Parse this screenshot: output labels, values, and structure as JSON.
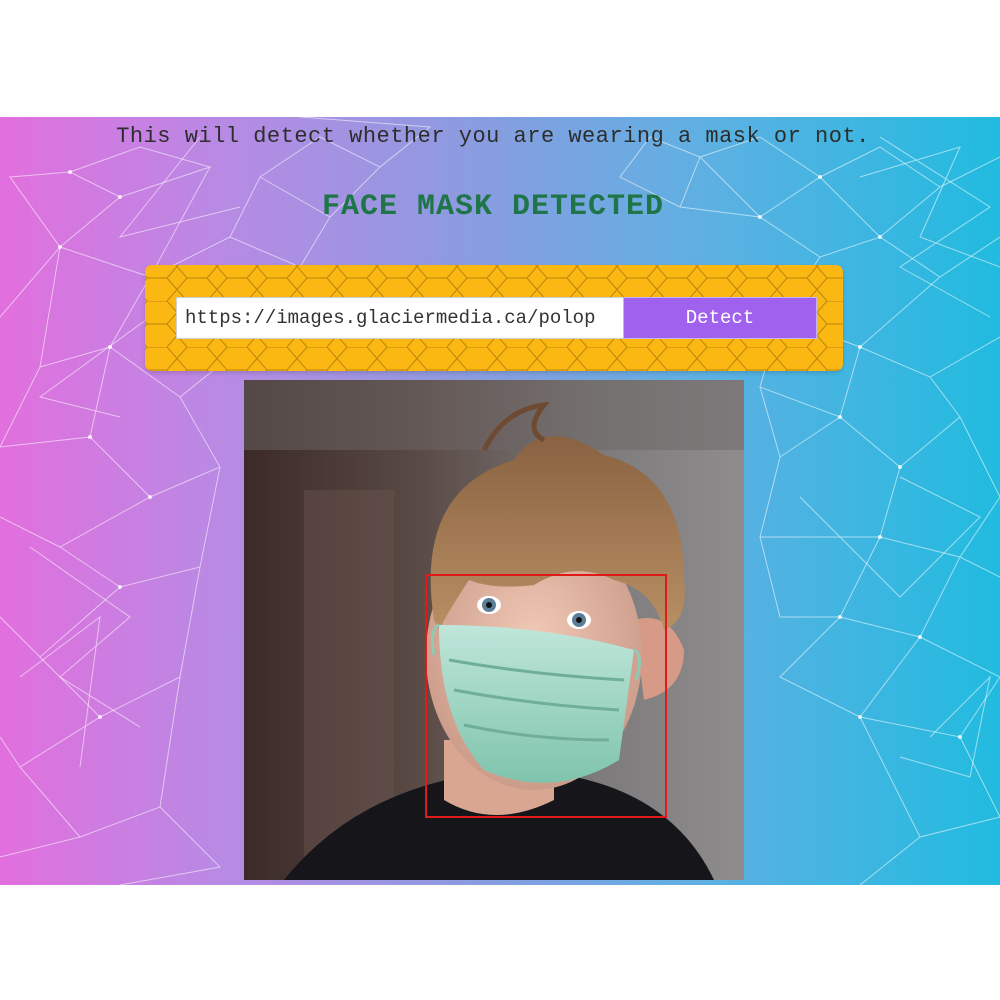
{
  "page": {
    "subtitle": "This will detect whether you are wearing a mask or not.",
    "status": "FACE MASK DETECTED"
  },
  "search": {
    "url_value": "https://images.glaciermedia.ca/polop",
    "detect_label": "Detect"
  },
  "result": {
    "detection_box_color": "#e01919",
    "mask_detected": true
  },
  "colors": {
    "status_text": "#1f7548",
    "panel": "#fcb812",
    "button": "#a062ee",
    "gradient_left": "#e26fde",
    "gradient_right": "#21bbe0"
  }
}
